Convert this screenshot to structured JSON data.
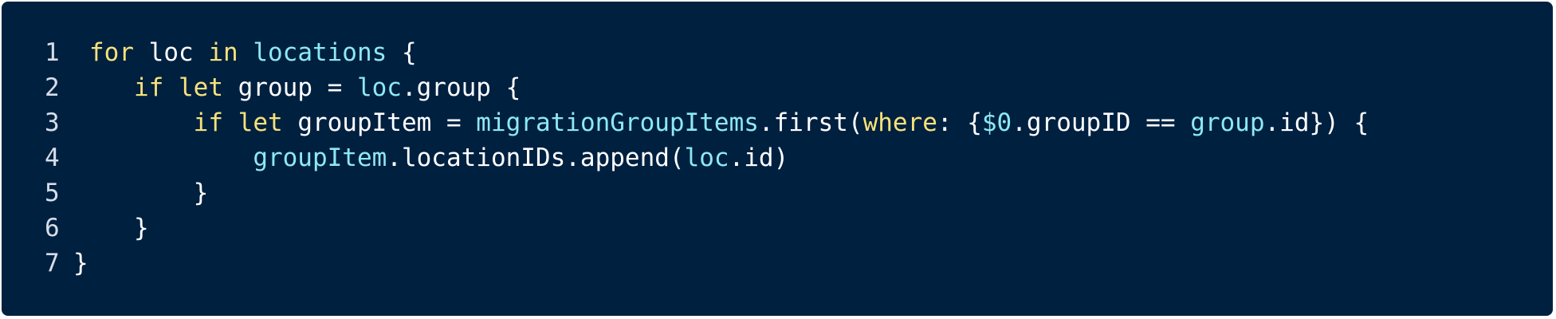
{
  "colors": {
    "background": "#002040",
    "keyword": "#f7e27a",
    "identifier": "#8de9f3",
    "text": "#ffffff",
    "line_number": "#d7dde8"
  },
  "lines": [
    {
      "number": "1",
      "tokens": [
        {
          "t": "for",
          "c": "kw"
        },
        {
          "t": " loc ",
          "c": "tx"
        },
        {
          "t": "in",
          "c": "kw"
        },
        {
          "t": " ",
          "c": "tx"
        },
        {
          "t": "locations",
          "c": "id"
        },
        {
          "t": " {",
          "c": "tx"
        }
      ]
    },
    {
      "number": "2",
      "tokens": [
        {
          "t": "   ",
          "c": "tx"
        },
        {
          "t": "if",
          "c": "kw"
        },
        {
          "t": " ",
          "c": "tx"
        },
        {
          "t": "let",
          "c": "kw"
        },
        {
          "t": " group = ",
          "c": "tx"
        },
        {
          "t": "loc",
          "c": "id"
        },
        {
          "t": ".group {",
          "c": "tx"
        }
      ]
    },
    {
      "number": "3",
      "tokens": [
        {
          "t": "       ",
          "c": "tx"
        },
        {
          "t": "if",
          "c": "kw"
        },
        {
          "t": " ",
          "c": "tx"
        },
        {
          "t": "let",
          "c": "kw"
        },
        {
          "t": " groupItem = ",
          "c": "tx"
        },
        {
          "t": "migrationGroupItems",
          "c": "id"
        },
        {
          "t": ".first(",
          "c": "tx"
        },
        {
          "t": "where",
          "c": "kw"
        },
        {
          "t": ": {",
          "c": "tx"
        },
        {
          "t": "$0",
          "c": "id"
        },
        {
          "t": ".groupID == ",
          "c": "tx"
        },
        {
          "t": "group",
          "c": "id"
        },
        {
          "t": ".id}) {",
          "c": "tx"
        }
      ]
    },
    {
      "number": "4",
      "tokens": [
        {
          "t": "           ",
          "c": "tx"
        },
        {
          "t": "groupItem",
          "c": "id"
        },
        {
          "t": ".locationIDs.append(",
          "c": "tx"
        },
        {
          "t": "loc",
          "c": "id"
        },
        {
          "t": ".id)",
          "c": "tx"
        }
      ]
    },
    {
      "number": "5",
      "tokens": [
        {
          "t": "       }",
          "c": "tx"
        }
      ]
    },
    {
      "number": "6",
      "tokens": [
        {
          "t": "   }",
          "c": "tx"
        }
      ]
    },
    {
      "number": "7",
      "tokens": [
        {
          "t": "}",
          "c": "tx"
        }
      ]
    }
  ]
}
